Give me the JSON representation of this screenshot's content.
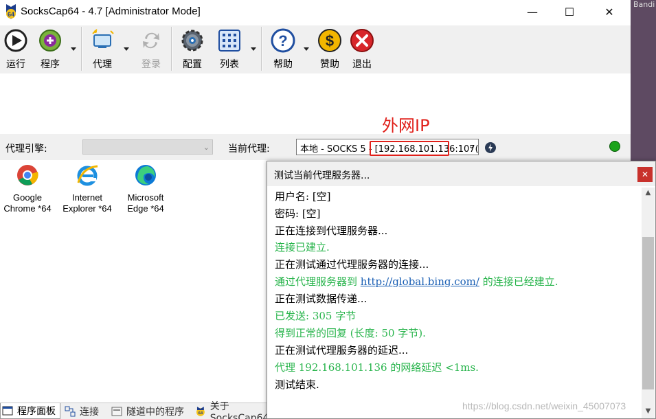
{
  "window": {
    "title": "SocksCap64 - 4.7 [Administrator Mode]",
    "minimize": "—",
    "maximize": "☐",
    "close": "✕",
    "background_text": "Bandi"
  },
  "toolbar": {
    "run": "运行",
    "program": "程序",
    "proxy": "代理",
    "login": "登录",
    "config": "配置",
    "list": "列表",
    "help": "帮助",
    "donate": "赞助",
    "exit": "退出"
  },
  "proxybar": {
    "engine_label": "代理引擎:",
    "engine_value": "",
    "current_proxy_label": "当前代理:",
    "current_proxy_value": "本地 - SOCKS 5 - [192.168.101.136:107(",
    "annotation": "外网IP",
    "status_color": "#1aa31a"
  },
  "programs": [
    {
      "line1": "Google",
      "line2": "Chrome *64",
      "icon": "chrome-icon"
    },
    {
      "line1": "Internet",
      "line2": "Explorer *64",
      "icon": "ie-icon"
    },
    {
      "line1": "Microsoft",
      "line2": "Edge *64",
      "icon": "edge-icon"
    }
  ],
  "tabs": [
    {
      "label": "程序面板",
      "icon": "panel-icon",
      "active": true
    },
    {
      "label": "连接",
      "icon": "connection-icon",
      "active": false
    },
    {
      "label": "隧道中的程序",
      "icon": "tunnel-icon",
      "active": false
    },
    {
      "label": "关于SocksCap64",
      "icon": "about-icon",
      "active": false
    }
  ],
  "dialog": {
    "title": "测试当前代理服务器...",
    "close": "✕",
    "lines": [
      {
        "text": "用户名: [空]",
        "status": "normal"
      },
      {
        "text": "密码: [空]",
        "status": "normal"
      },
      {
        "text": "正在连接到代理服务器...",
        "status": "normal"
      },
      {
        "text": "连接已建立.",
        "status": "ok"
      },
      {
        "text": "正在测试通过代理服务器的连接...",
        "status": "normal"
      },
      {
        "pre": "通过代理服务器到 ",
        "link": "http://global.bing.com/",
        "post": " 的连接已经建立.",
        "status": "ok"
      },
      {
        "text": "正在测试数据传递...",
        "status": "normal"
      },
      {
        "text": "已发送: 305 字节",
        "status": "ok"
      },
      {
        "text": "得到正常的回复 (长度: 50 字节).",
        "status": "ok"
      },
      {
        "text": "正在测试代理服务器的延迟...",
        "status": "normal"
      },
      {
        "text": "代理 192.168.101.136 的网络延迟 <1ms.",
        "status": "ok"
      },
      {
        "text": "测试结束.",
        "status": "normal"
      }
    ]
  },
  "watermark": "https://blog.csdn.net/weixin_45007073",
  "colors": {
    "ok_text": "#27b44b",
    "annotation": "#e0201a",
    "link": "#1a5fb4"
  }
}
